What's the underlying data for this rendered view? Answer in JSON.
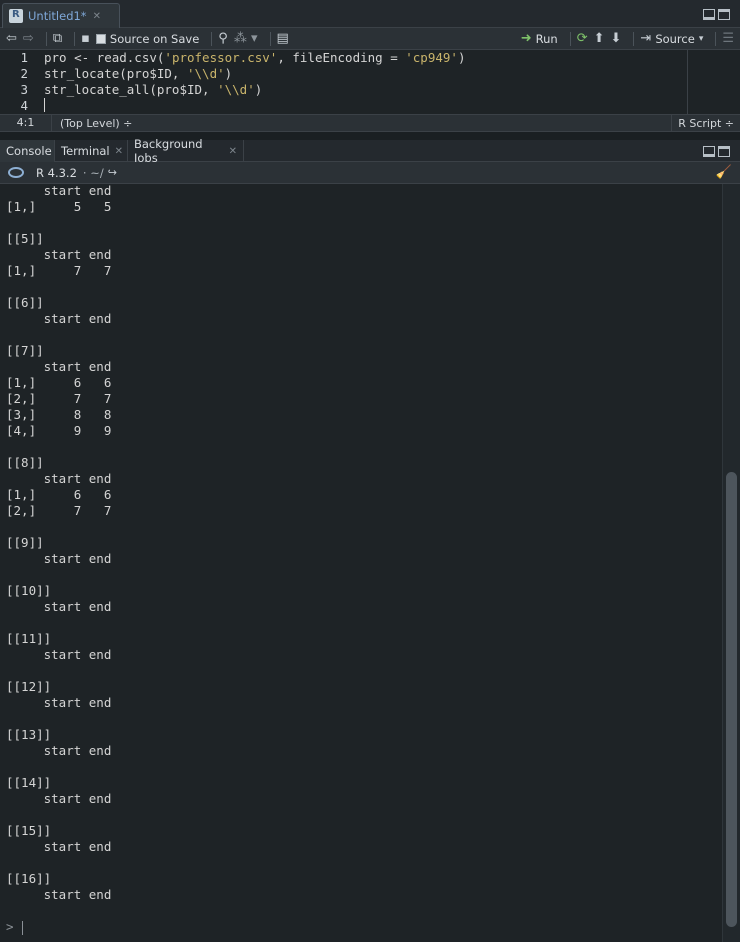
{
  "source_pane": {
    "tab_title": "Untitled1*",
    "toolbar": {
      "source_on_save": "Source on Save",
      "run": "Run",
      "source": "Source"
    },
    "code_lines": [
      {
        "num": "1",
        "pre": "pro <- read.csv(",
        "s1": "'professor.csv'",
        "mid": ", fileEncoding = ",
        "s2": "'cp949'",
        "post": ")"
      },
      {
        "num": "2",
        "pre": "str_locate(pro$ID, ",
        "s1": "'\\\\d'",
        "mid": ")",
        "s2": "",
        "post": ""
      },
      {
        "num": "3",
        "pre": "str_locate_all(pro$ID, ",
        "s1": "'\\\\d'",
        "mid": ")",
        "s2": "",
        "post": ""
      },
      {
        "num": "4",
        "pre": "",
        "s1": "",
        "mid": "",
        "s2": "",
        "post": ""
      }
    ],
    "status": {
      "position": "4:1",
      "scope": "(Top Level) ÷",
      "language": "R Script ÷"
    }
  },
  "console_pane": {
    "tabs": [
      "Console",
      "Terminal",
      "Background Jobs"
    ],
    "r_version": "R 4.3.2",
    "path": "· ~/",
    "output_lines": [
      "     start end",
      "[1,]     5   5",
      "",
      "[[5]]",
      "     start end",
      "[1,]     7   7",
      "",
      "[[6]]",
      "     start end",
      "",
      "[[7]]",
      "     start end",
      "[1,]     6   6",
      "[2,]     7   7",
      "[3,]     8   8",
      "[4,]     9   9",
      "",
      "[[8]]",
      "     start end",
      "[1,]     6   6",
      "[2,]     7   7",
      "",
      "[[9]]",
      "     start end",
      "",
      "[[10]]",
      "     start end",
      "",
      "[[11]]",
      "     start end",
      "",
      "[[12]]",
      "     start end",
      "",
      "[[13]]",
      "     start end",
      "",
      "[[14]]",
      "     start end",
      "",
      "[[15]]",
      "     start end",
      "",
      "[[16]]",
      "     start end"
    ],
    "prompt": ">"
  },
  "colors": {
    "string": "#c9b46b",
    "background": "#1e2326",
    "tab_title": "#7fa8d8"
  }
}
